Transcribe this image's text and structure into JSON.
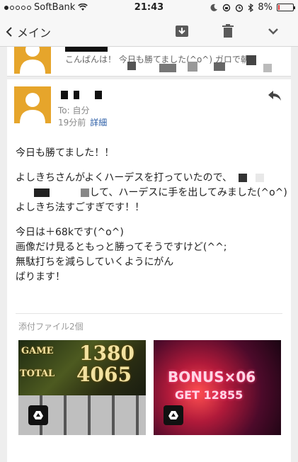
{
  "status_bar": {
    "carrier": "SoftBank",
    "time": "21:43",
    "battery": "8%",
    "battery_level": 0.08,
    "battery_color": "#e33333"
  },
  "toolbar": {
    "back_label": "メイン",
    "icons": [
      "archive-icon",
      "trash-icon",
      "chevron-down-icon"
    ]
  },
  "previous_mail": {
    "snippet": "こんばんは！ 今日も勝てました(^o^) ガロで朝"
  },
  "mail": {
    "to_line": "To: 自分",
    "time_ago": "19分前",
    "detail_link": "詳細",
    "body": {
      "p1": "今日も勝てました！！",
      "p2_l1": "よしきちさんがよくハーデスを打っていたので、",
      "p2_l2": "して、ハーデスに手を出してみました(^o^)",
      "p2_l3": "よしきち法すごすぎです！！",
      "p3_l1": "今日は＋68kです(^o^)",
      "p3_l2": "画像だけ見るともっと勝ってそうですけど(^^;",
      "p3_l3": "無駄打ちを減らしていくようにがん",
      "p3_l4": "ばります！"
    }
  },
  "attachments": {
    "label": "添付ファイル2個",
    "items": [
      {
        "line1": "GAME",
        "line2": "1380",
        "line3": "TOTAL",
        "line4": "4065"
      },
      {
        "line1": "BONUS×06",
        "line2": "GET 12855"
      }
    ]
  },
  "colors": {
    "avatar": "#e6a52b",
    "link": "#2d5fa7"
  }
}
